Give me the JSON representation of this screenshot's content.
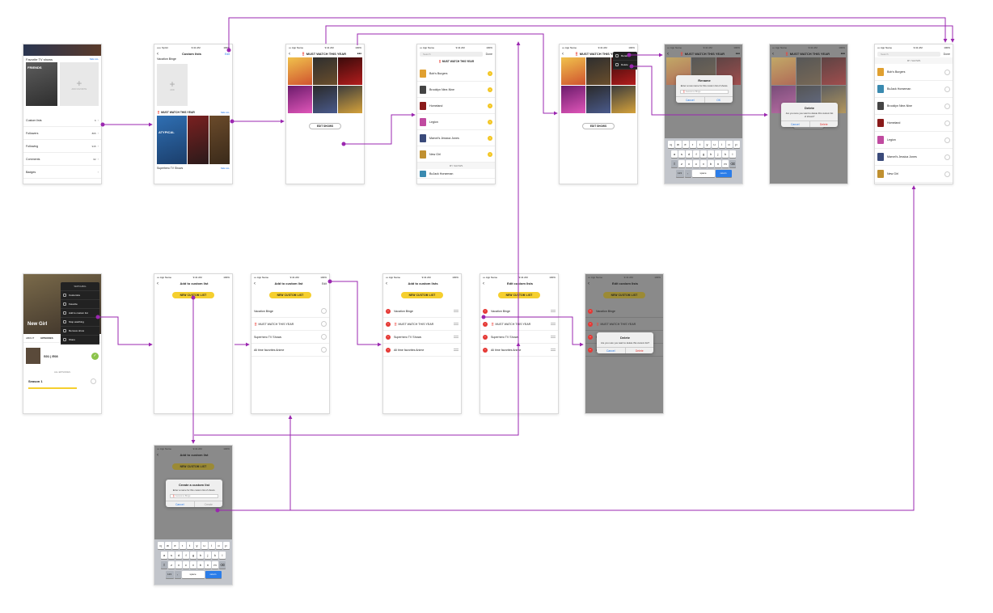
{
  "colors": {
    "connector": "#9b27b0",
    "accent": "#f5cf2e",
    "delete": "#e53935",
    "link": "#2b7de9"
  },
  "status": {
    "carrier_sprint": "••••• Sprint",
    "carrier_app": "••• App Name",
    "time": "9:41 AM",
    "battery": "100%"
  },
  "s1": {
    "favorite_title": "Favorite TV shows",
    "see_all": "SEE ALL",
    "poster_label": "FRIENDS",
    "add_favorite": "ADD FAVORITE",
    "rows": [
      {
        "name": "Custom lists",
        "count": "6"
      },
      {
        "name": "Followers",
        "count": "865"
      },
      {
        "name": "Following",
        "count": "915"
      },
      {
        "name": "Comments",
        "count": "62"
      },
      {
        "name": "Badges",
        "count": ""
      }
    ]
  },
  "s2": {
    "title": "Custom lists",
    "edit": "Edit",
    "list1": "Vacation Binge",
    "add": "ADD",
    "list2": "‼️ MUST WATCH THIS YEAR",
    "see_all": "SEE ALL",
    "list3": "Superhero TV Shows",
    "poster_label": "ATYPICAL"
  },
  "s3": {
    "title": "‼️ MUST WATCH THIS YEAR",
    "edit_shows": "EDIT SHOWS"
  },
  "s4": {
    "search": "Search",
    "done": "Done",
    "section": "‼️ MUST WATCH THIS YEAR",
    "my_shows": "MY SHOWS",
    "shows": [
      "Bob's Burgers",
      "Brooklyn Nine-Nine",
      "Homeland",
      "Legion",
      "Marvel's Jessica Jones",
      "New Girl"
    ],
    "extra": "BoJack Horseman"
  },
  "s5": {
    "title": "‼️ MUST WATCH THIS YEAR",
    "menu_rename": "Rename",
    "menu_delete": "Delete",
    "edit_shows": "EDIT SHOWS"
  },
  "s6": {
    "title": "‼️ MUST WATCH THIS YEAR",
    "dialog_title": "Rename",
    "dialog_msg": "Enter a new name for this custom list of shows.",
    "input_placeholder": "‼️ Awesome Binge",
    "cancel": "Cancel",
    "ok": "OK",
    "keys_row1": [
      "q",
      "w",
      "e",
      "r",
      "t",
      "y",
      "u",
      "i",
      "o",
      "p"
    ],
    "keys_row2": [
      "a",
      "s",
      "d",
      "f",
      "g",
      "h",
      "j",
      "k",
      "l"
    ],
    "keys_row3": [
      "z",
      "x",
      "c",
      "v",
      "b",
      "n",
      "m"
    ],
    "key_123": "123",
    "key_space": "space",
    "key_return": "return"
  },
  "s7": {
    "title": "‼️ MUST WATCH THIS YEAR",
    "dialog_title": "Delete",
    "dialog_msg": "Are you sure you want to delete this custom list of shows?",
    "cancel": "Cancel",
    "delete": "Delete",
    "edit_shows": "EDIT SHOWS"
  },
  "s8": {
    "search": "Search",
    "done": "Done",
    "my_shows": "MY SHOWS",
    "shows": [
      "Bob's Burgers",
      "BoJack Horseman",
      "Brooklyn Nine-Nine",
      "Homeland",
      "Legion",
      "Marvel's Jessica Jones",
      "New Girl"
    ]
  },
  "b1": {
    "show_title": "New Girl",
    "tab_about": "ABOUT",
    "tab_episodes": "EPISODES",
    "episode": "S01 | E08",
    "all_episodes": "ALL EPISODES",
    "season": "Season 1",
    "menu": [
      "WATCHING",
      "Customize",
      "Favorite",
      "Add to custom list",
      "Stop watching",
      "Remove show",
      "Share"
    ]
  },
  "b2": {
    "title": "Add to custom list",
    "new_list": "NEW CUSTOM LIST"
  },
  "b3": {
    "title": "Add to custom list",
    "edit": "Edit",
    "new_list": "NEW CUSTOM LIST",
    "lists": [
      "Vacation Binge",
      "‼️ MUST WATCH THIS YEAR",
      "Superhero TV Shows",
      "All time favorites Anime"
    ]
  },
  "b4": {
    "title": "Add to custom lists",
    "new_list": "NEW CUSTOM LIST",
    "lists": [
      "Vacation Binge",
      "‼️ MUST WATCH THIS YEAR",
      "Superhero TV Shows",
      "All time favorites Anime"
    ]
  },
  "b5": {
    "title": "Edit custom lists",
    "new_list": "NEW CUSTOM LIST",
    "lists": [
      "Vacation Binge",
      "‼️ MUST WATCH THIS YEAR",
      "Superhero TV Shows",
      "All time favorites Anime"
    ]
  },
  "b6": {
    "title": "Edit custom lists",
    "new_list": "NEW CUSTOM LIST",
    "lists": [
      "Vacation Binge",
      "‼️ MUST WATCH THIS YEAR",
      "Superhero TV Shows",
      "All time favorites Anime"
    ],
    "dialog_title": "Delete",
    "dialog_msg": "Are you sure you want to delete this custom list?",
    "cancel": "Cancel",
    "delete": "Delete"
  },
  "c1": {
    "title": "Add to custom list",
    "new_list": "NEW CUSTOM LIST",
    "dialog_title": "Create a custom list",
    "dialog_msg": "Enter a name for this custom list of shows.",
    "input_placeholder": "‼️ Awesome Binge",
    "cancel": "Cancel",
    "create": "Create"
  }
}
